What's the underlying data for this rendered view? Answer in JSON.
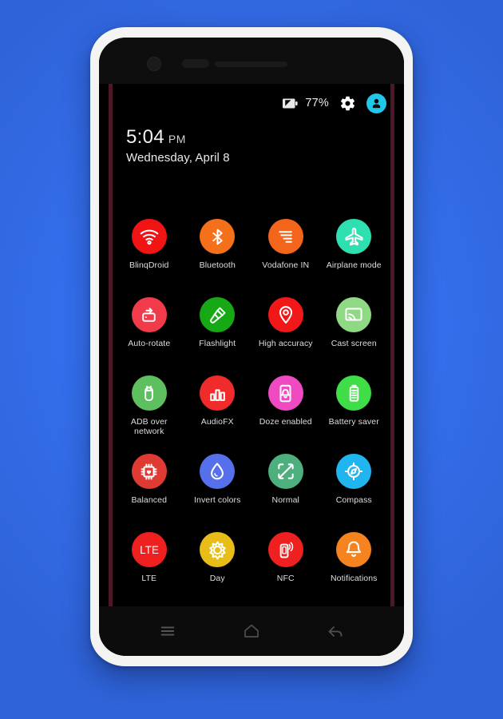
{
  "device": {
    "frame_color": "#f4f4f2",
    "screen_background": "#000000",
    "wallpaper_color": "#3570ee",
    "panel_edge_color": "#4d1726"
  },
  "statusbar": {
    "battery_icon": "battery-charging-icon",
    "battery_percent": "77%",
    "settings_icon": "gear-icon",
    "account_icon": "user-avatar-icon",
    "avatar_color": "#20c7e8"
  },
  "clock": {
    "time": "5:04",
    "ampm": "PM",
    "date": "Wednesday, April 8"
  },
  "tiles": [
    {
      "label": "BlinqDroid",
      "icon": "wifi-icon",
      "color": "#f01414"
    },
    {
      "label": "Bluetooth",
      "icon": "bluetooth-icon",
      "color": "#f5701a"
    },
    {
      "label": "Vodafone IN",
      "icon": "signal-bars-icon",
      "color": "#f4651c"
    },
    {
      "label": "Airplane mode",
      "icon": "airplane-icon",
      "color": "#2ee0b0"
    },
    {
      "label": "Auto-rotate",
      "icon": "auto-rotate-icon",
      "color": "#f23b4a"
    },
    {
      "label": "Flashlight",
      "icon": "flashlight-icon",
      "color": "#17a816"
    },
    {
      "label": "High accuracy",
      "icon": "location-pin-icon",
      "color": "#f01818"
    },
    {
      "label": "Cast screen",
      "icon": "cast-screen-icon",
      "color": "#8fd884"
    },
    {
      "label": "ADB over network",
      "icon": "android-bug-icon",
      "color": "#5dbf5d"
    },
    {
      "label": "AudioFX",
      "icon": "equalizer-icon",
      "color": "#ef2b2b"
    },
    {
      "label": "Doze enabled",
      "icon": "phone-bell-icon",
      "color": "#ef4ac2"
    },
    {
      "label": "Battery saver",
      "icon": "battery-icon",
      "color": "#3fdd48"
    },
    {
      "label": "Balanced",
      "icon": "cpu-heart-icon",
      "color": "#e03a34"
    },
    {
      "label": "Invert colors",
      "icon": "water-drop-icon",
      "color": "#5570ea"
    },
    {
      "label": "Normal",
      "icon": "screen-frame-icon",
      "color": "#4caf7d"
    },
    {
      "label": "Compass",
      "icon": "compass-icon",
      "color": "#21b5f0"
    },
    {
      "label": "LTE",
      "icon": "lte-text-icon",
      "color": "#ef2020"
    },
    {
      "label": "Day",
      "icon": "sun-icon",
      "color": "#e8bd17"
    },
    {
      "label": "NFC",
      "icon": "nfc-phone-icon",
      "color": "#ef2020"
    },
    {
      "label": "Notifications",
      "icon": "bell-icon",
      "color": "#f5831f"
    }
  ],
  "partial_tiles": [
    {
      "label": "",
      "icon": "crop-square-icon",
      "color": "#f20d0d"
    },
    {
      "label": "",
      "icon": "stop-square-icon",
      "color": "#e5b50c"
    },
    {
      "label": "",
      "icon": "copy-windows-icon",
      "color": "#27c327"
    }
  ],
  "partial_tiles_row2": [
    {
      "label": "",
      "icon": "circle-icon",
      "color": "#2b3a8c"
    },
    {
      "label": "",
      "icon": "circle-icon",
      "color": "#8c1f20"
    },
    {
      "label": "",
      "icon": "keyboard-icon",
      "color": "#a0661a"
    },
    {
      "label": "",
      "icon": "circle-icon",
      "color": "#1a6b26"
    }
  ],
  "fab": {
    "icon": "back-chevron-icon",
    "color": "#f20d0d"
  },
  "navbar": {
    "menu_icon": "menu-icon",
    "home_icon": "home-icon",
    "back_icon": "back-arrow-icon"
  }
}
